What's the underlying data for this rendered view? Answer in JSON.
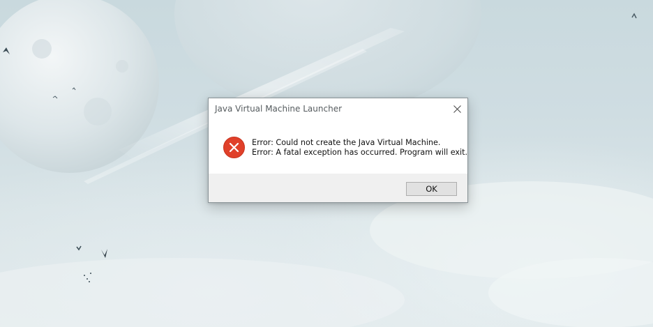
{
  "dialog": {
    "title": "Java Virtual Machine Launcher",
    "icon": "error-icon",
    "message_lines": [
      "Error: Could not create the Java Virtual Machine.",
      "Error: A fatal exception has occurred. Program will exit."
    ],
    "ok_label": "OK",
    "close_icon": "close-icon"
  },
  "colors": {
    "error_red": "#e0402a",
    "dialog_footer": "#f0f0f0",
    "button_face": "#e1e1e1"
  }
}
